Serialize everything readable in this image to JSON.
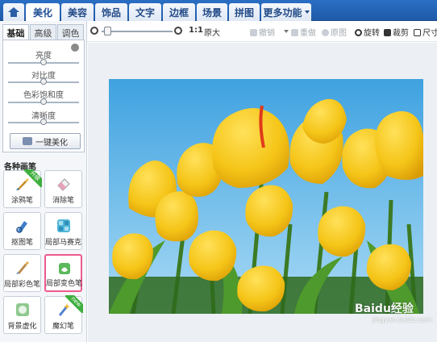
{
  "nav": {
    "tabs": [
      {
        "label": "美化",
        "active": true
      },
      {
        "label": "美容"
      },
      {
        "label": "饰品"
      },
      {
        "label": "文字"
      },
      {
        "label": "边框"
      },
      {
        "label": "场景"
      },
      {
        "label": "拼图"
      },
      {
        "label": "更多功能"
      }
    ]
  },
  "left_panel": {
    "subtabs": [
      {
        "label": "基础",
        "active": true
      },
      {
        "label": "高级"
      },
      {
        "label": "调色"
      }
    ],
    "sliders": [
      {
        "label": "亮度",
        "value": 0.5
      },
      {
        "label": "对比度",
        "value": 0.5
      },
      {
        "label": "色彩饱和度",
        "value": 0.5
      },
      {
        "label": "清晰度",
        "value": 0.5
      }
    ],
    "one_click_label": "一键美化",
    "brush_section_title": "各种画笔",
    "tools": [
      {
        "label": "涂鸦笔",
        "badge": "升级"
      },
      {
        "label": "消除笔"
      },
      {
        "label": "抠图笔"
      },
      {
        "label": "局部马赛克"
      },
      {
        "label": "局部彩色笔"
      },
      {
        "label": "局部变色笔",
        "selected": true
      },
      {
        "label": "背景虚化"
      },
      {
        "label": "魔幻笔",
        "badge": "new"
      }
    ]
  },
  "toolbar": {
    "zoom_value": 0.03,
    "ratio_label": "1:1",
    "original_label": "原大",
    "undo_label": "撤销",
    "redo_label": "重做",
    "restore_label": "原图",
    "rotate_label": "旋转",
    "crop_label": "裁剪",
    "size_label": "尺寸"
  },
  "watermark": {
    "brand": "Baidu经验",
    "url": "jingyan.baidu.com"
  },
  "colors": {
    "nav_blue": "#1f5aa8",
    "tab_highlight": "#ffffff",
    "selected_border": "#ee5a8d",
    "badge_green": "#3eae3e",
    "tulip_yellow": "#f5c518",
    "sky_blue": "#5bb6ea",
    "stem_green": "#3c7a24"
  }
}
